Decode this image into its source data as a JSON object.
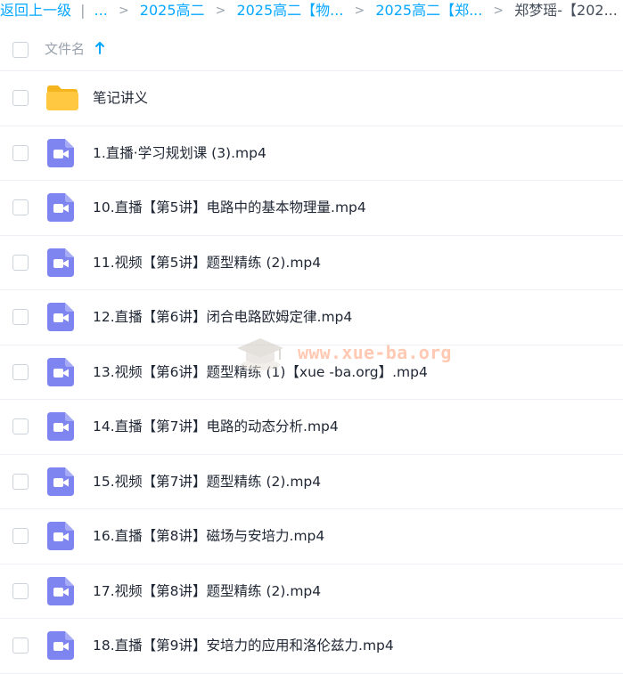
{
  "breadcrumb": {
    "back": "返回上一级",
    "pipe": "|",
    "ellipsis": "...",
    "sep": ">",
    "items": [
      "2025高二",
      "2025高二【物...",
      "2025高二【郑..."
    ],
    "current": "郑梦瑶-【202..."
  },
  "header": {
    "column_name": "文件名"
  },
  "colors": {
    "accent": "#06a7ff",
    "video_icon": "#7e84f0",
    "folder": "#ffc840"
  },
  "files": [
    {
      "name": "笔记讲义",
      "type": "folder"
    },
    {
      "name": "1.直播·学习规划课 (3).mp4",
      "type": "video"
    },
    {
      "name": "10.直播【第5讲】电路中的基本物理量.mp4",
      "type": "video"
    },
    {
      "name": "11.视频【第5讲】题型精练 (2).mp4",
      "type": "video"
    },
    {
      "name": "12.直播【第6讲】闭合电路欧姆定律.mp4",
      "type": "video"
    },
    {
      "name": "13.视频【第6讲】题型精练 (1)【xue -ba.org】.mp4",
      "type": "video"
    },
    {
      "name": "14.直播【第7讲】电路的动态分析.mp4",
      "type": "video"
    },
    {
      "name": "15.视频【第7讲】题型精练 (2).mp4",
      "type": "video"
    },
    {
      "name": "16.直播【第8讲】磁场与安培力.mp4",
      "type": "video"
    },
    {
      "name": "17.视频【第8讲】题型精练 (2).mp4",
      "type": "video"
    },
    {
      "name": "18.直播【第9讲】安培力的应用和洛伦兹力.mp4",
      "type": "video"
    }
  ],
  "watermark": {
    "text": "www.xue-ba.org"
  }
}
